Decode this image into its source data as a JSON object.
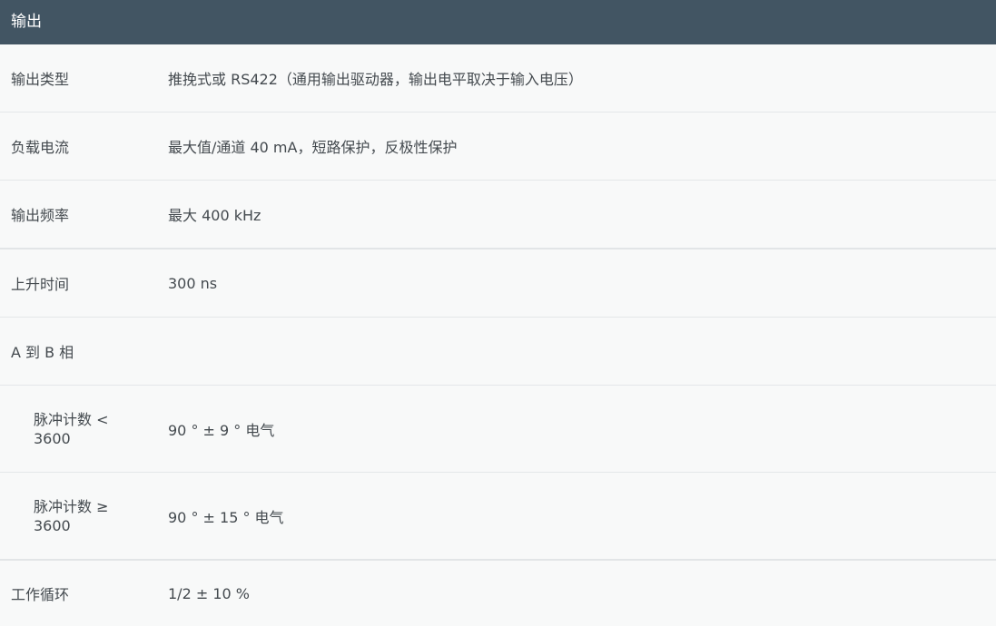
{
  "header": {
    "title": "输出"
  },
  "rows": [
    {
      "label": "输出类型",
      "value": "推挽式或 RS422（通用输出驱动器，输出电平取决于输入电压）"
    },
    {
      "label": "负载电流",
      "value": "最大值/通道 40 mA，短路保护，反极性保护"
    },
    {
      "label": "输出频率",
      "value": "最大 400 kHz"
    },
    {
      "label": "上升时间",
      "value": "300 ns"
    },
    {
      "label": "A 到 B 相",
      "value": ""
    },
    {
      "label": "脉冲计数 < 3600",
      "value": "90 ° ± 9 ° 电气"
    },
    {
      "label": "脉冲计数 ≥ 3600",
      "value": "90 ° ± 15 ° 电气"
    },
    {
      "label": "工作循环",
      "value": "1/2 ± 10 %"
    }
  ]
}
